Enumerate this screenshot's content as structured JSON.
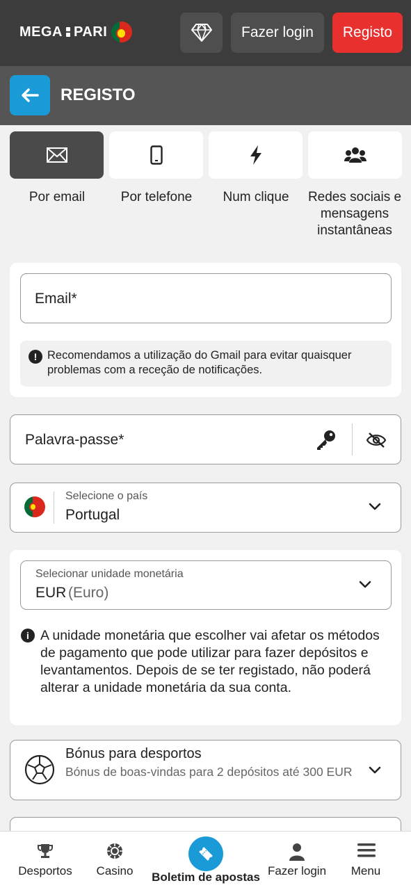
{
  "header": {
    "logo_left": "MEGA",
    "logo_right": "PARI",
    "login_label": "Fazer login",
    "register_label": "Registo"
  },
  "subheader": {
    "title": "REGISTO"
  },
  "methods": [
    {
      "label": "Por email",
      "icon": "envelope-icon",
      "active": true
    },
    {
      "label": "Por telefone",
      "icon": "phone-icon",
      "active": false
    },
    {
      "label": "Num clique",
      "icon": "lightning-icon",
      "active": false
    },
    {
      "label": "Redes sociais e mensagens instantâneas",
      "icon": "users-icon",
      "active": false
    }
  ],
  "email": {
    "placeholder": "Email*",
    "notice": "Recomendamos a utilização do Gmail para evitar quaisquer problemas com a receção de notificações."
  },
  "password": {
    "placeholder": "Palavra-passe*"
  },
  "country": {
    "label": "Selecione o país",
    "value": "Portugal"
  },
  "currency": {
    "label": "Selecionar unidade monetária",
    "code": "EUR",
    "name": "(Euro)",
    "info": "A unidade monetária que escolher vai afetar os métodos de pagamento que pode utilizar para fazer depósitos e levantamentos. Depois de se ter registado, não poderá alterar a unidade monetária da sua conta."
  },
  "bonus": {
    "title": "Bónus para desportos",
    "description": "Bónus de boas-vindas para 2 depósitos até 300 EUR"
  },
  "bottom_nav": {
    "sports": "Desportos",
    "casino": "Casino",
    "betslip": "Boletim de apostas",
    "login": "Fazer login",
    "menu": "Menu"
  },
  "colors": {
    "header_bg": "#3c3c3c",
    "accent_blue": "#1a9bd8",
    "register_red": "#e8302e"
  }
}
